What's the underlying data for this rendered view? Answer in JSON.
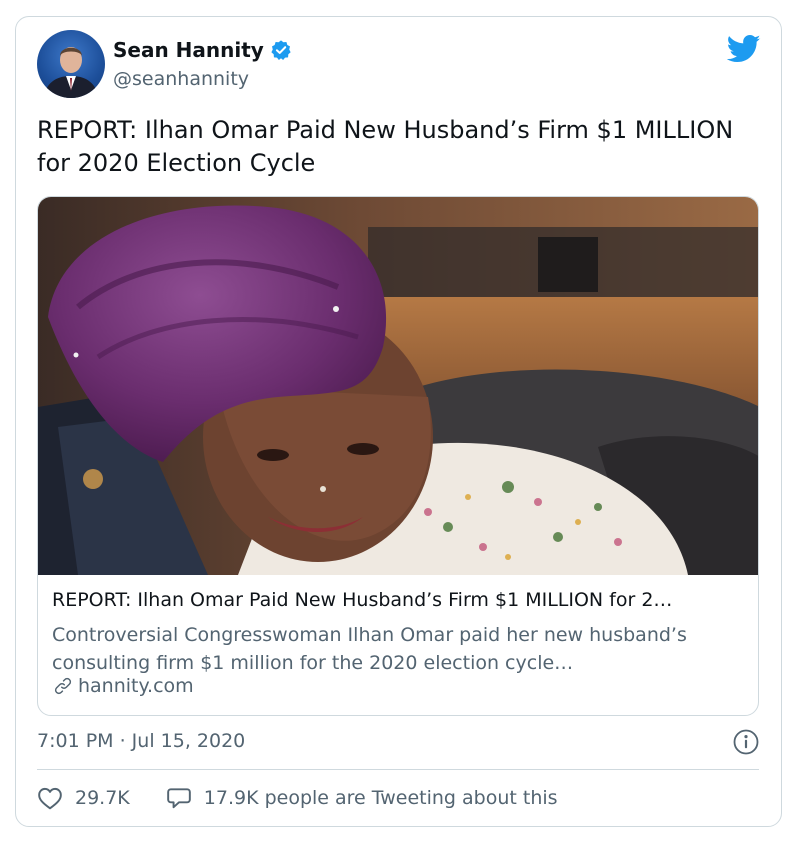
{
  "author": {
    "name": "Sean Hannity",
    "handle": "@seanhannity"
  },
  "tweet": {
    "text": "REPORT: Ilhan Omar Paid New Husband’s Firm $1 MILLION for 2020 Election Cycle"
  },
  "link_card": {
    "title": "REPORT: Ilhan Omar Paid New Husband’s Firm $1 MILLION for 2…",
    "description": "Controversial Congresswoman Ilhan Omar paid her new husband’s consulting firm $1 million for the 2020 election cycle…",
    "domain": "hannity.com",
    "image_icon": "news-photo"
  },
  "timestamp": "7:01 PM · Jul 15, 2020",
  "stats": {
    "likes": "29.7K",
    "tweeting": "17.9K people are Tweeting about this"
  },
  "colors": {
    "twitter_blue": "#1d9bf0",
    "muted_text": "#536471",
    "border": "#cfd9de"
  },
  "icons": {
    "verified": "verified-badge-icon",
    "bird": "twitter-bird-icon",
    "info": "info-icon",
    "like": "heart-icon",
    "reply": "speech-bubble-icon",
    "link": "link-icon"
  }
}
